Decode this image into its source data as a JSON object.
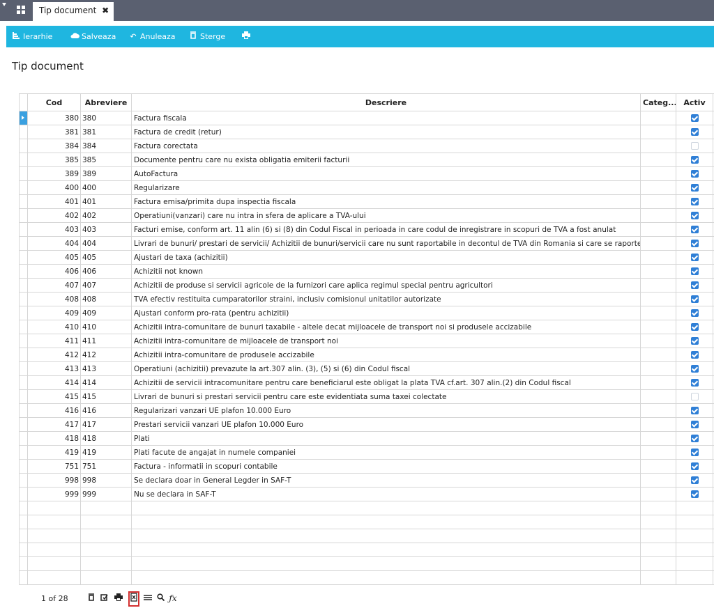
{
  "tab": {
    "title": "Tip document",
    "close": "✖"
  },
  "toolbar": {
    "hierarchy": "Ierarhie",
    "save": "Salveaza",
    "cancel": "Anuleaza",
    "delete": "Sterge"
  },
  "page": {
    "title": "Tip document"
  },
  "grid": {
    "headers": {
      "cod": "Cod",
      "abbr": "Abreviere",
      "desc": "Descriere",
      "categ": "Categ...",
      "active": "Activ"
    },
    "rows": [
      {
        "cod": "380",
        "abbr": "380",
        "desc": "Factura fiscala",
        "active": true
      },
      {
        "cod": "381",
        "abbr": "381",
        "desc": "Factura de credit (retur)",
        "active": true
      },
      {
        "cod": "384",
        "abbr": "384",
        "desc": "Factura corectata",
        "active": false
      },
      {
        "cod": "385",
        "abbr": "385",
        "desc": "Documente pentru care nu exista obligatia emiterii facturii",
        "active": true
      },
      {
        "cod": "389",
        "abbr": "389",
        "desc": "AutoFactura",
        "active": true
      },
      {
        "cod": "400",
        "abbr": "400",
        "desc": "Regularizare",
        "active": true
      },
      {
        "cod": "401",
        "abbr": "401",
        "desc": "Factura emisa/primita dupa inspectia fiscala",
        "active": true
      },
      {
        "cod": "402",
        "abbr": "402",
        "desc": "Operatiuni(vanzari) care nu intra in sfera de aplicare a TVA-ului",
        "active": true
      },
      {
        "cod": "403",
        "abbr": "403",
        "desc": "Facturi emise, conform art. 11 alin (6) si (8) din Codul Fiscal in perioada in care codul de inregistrare in scopuri de TVA a fost anulat",
        "active": true
      },
      {
        "cod": "404",
        "abbr": "404",
        "desc": "Livrari de bunuri/ prestari de servicii/ Achizitii de bunuri/servicii care nu sunt raportabile in decontul de TVA din Romania si care se raporte",
        "active": true
      },
      {
        "cod": "405",
        "abbr": "405",
        "desc": "Ajustari de taxa (achizitii)",
        "active": true
      },
      {
        "cod": "406",
        "abbr": "406",
        "desc": "Achizitii not known",
        "active": true
      },
      {
        "cod": "407",
        "abbr": "407",
        "desc": "Achizitii de produse si servicii agricole de la furnizori care aplica regimul special pentru agricultori",
        "active": true
      },
      {
        "cod": "408",
        "abbr": "408",
        "desc": "TVA efectiv restituita cumparatorilor straini, inclusiv comisionul unitatilor autorizate",
        "active": true
      },
      {
        "cod": "409",
        "abbr": "409",
        "desc": "Ajustari conform pro-rata (pentru achizitii)",
        "active": true
      },
      {
        "cod": "410",
        "abbr": "410",
        "desc": "Achizitii intra-comunitare de bunuri taxabile - altele decat mijloacele de transport noi si produsele accizabile",
        "active": true
      },
      {
        "cod": "411",
        "abbr": "411",
        "desc": "Achizitii intra-comunitare de  mijloacele de transport noi",
        "active": true
      },
      {
        "cod": "412",
        "abbr": "412",
        "desc": "Achizitii intra-comunitare de produsele accizabile",
        "active": true
      },
      {
        "cod": "413",
        "abbr": "413",
        "desc": "Operatiuni (achizitii) prevazute la art.307 alin. (3), (5) si (6) din Codul fiscal",
        "active": true
      },
      {
        "cod": "414",
        "abbr": "414",
        "desc": "Achizitii de servicii intracomunitare pentru care beneficiarul este obligat la plata TVA cf.art. 307 alin.(2) din Codul fiscal",
        "active": true
      },
      {
        "cod": "415",
        "abbr": "415",
        "desc": "Livrari de bunuri si prestari servicii pentru care este evidentiata suma taxei colectate",
        "active": false
      },
      {
        "cod": "416",
        "abbr": "416",
        "desc": "Regularizari vanzari UE plafon 10.000 Euro",
        "active": true
      },
      {
        "cod": "417",
        "abbr": "417",
        "desc": "Prestari servicii vanzari UE plafon 10.000 Euro",
        "active": true
      },
      {
        "cod": "418",
        "abbr": "418",
        "desc": "Plati",
        "active": true
      },
      {
        "cod": "419",
        "abbr": "419",
        "desc": "Plati facute de angajat in numele companiei",
        "active": true
      },
      {
        "cod": "751",
        "abbr": "751",
        "desc": "Factura - informatii in scopuri contabile",
        "active": true
      },
      {
        "cod": "998",
        "abbr": "998",
        "desc": "Se declara doar in General Legder in SAF-T",
        "active": true
      },
      {
        "cod": "999",
        "abbr": "999",
        "desc": "Nu se declara in SAF-T",
        "active": true
      }
    ]
  },
  "footer": {
    "pager": "1 of 28"
  },
  "icons": {
    "hierarchy": "hierarchy-icon",
    "save": "cloud-save-icon",
    "cancel": "undo-icon",
    "delete": "trash-icon",
    "print": "printer-icon",
    "excel": "excel-export-icon",
    "search": "search-icon",
    "formula": "formula-icon"
  },
  "colors": {
    "toolbar": "#1fb6e0",
    "topbar": "#5a6070",
    "checkbox": "#2f7fd6",
    "selection": "#3aa0e0",
    "highlight": "#d32f2f"
  }
}
